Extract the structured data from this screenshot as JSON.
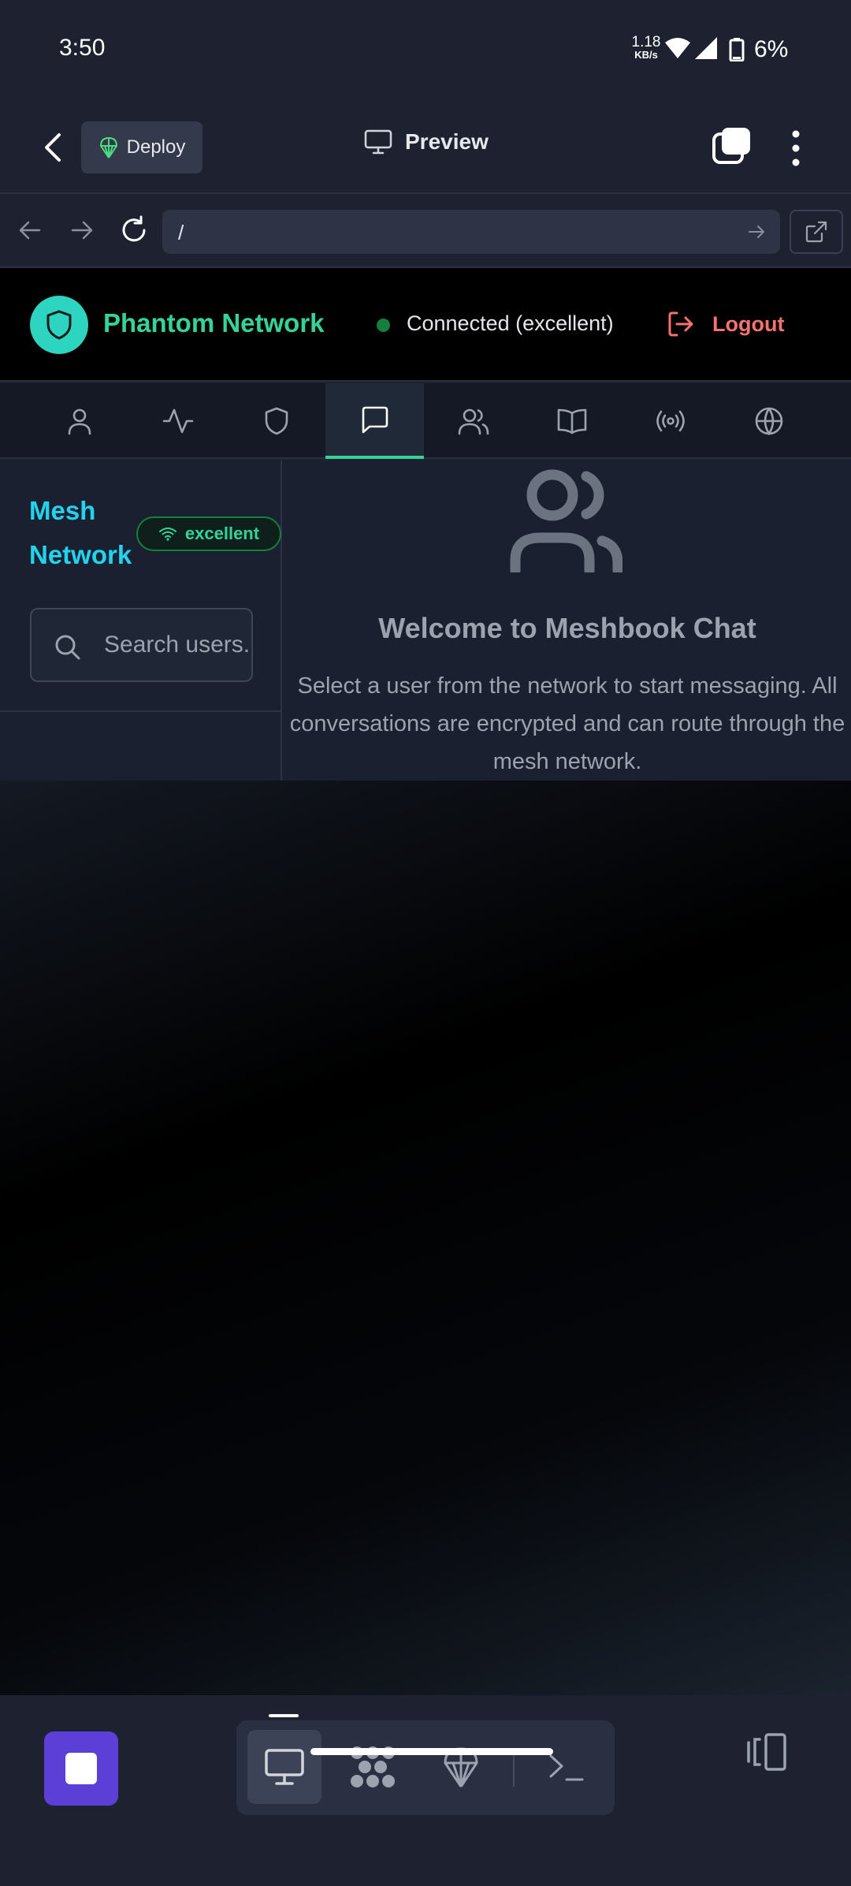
{
  "status_bar": {
    "time": "3:50",
    "net_speed_value": "1.18",
    "net_speed_unit": "KB/s",
    "battery": "6%"
  },
  "toolbar": {
    "deploy_label": "Deploy",
    "preview_label": "Preview"
  },
  "browser": {
    "url": "/"
  },
  "app": {
    "brand_name": "Phantom Network",
    "connection_status": "Connected (excellent)",
    "logout_label": "Logout",
    "nav_tabs": [
      {
        "name": "profile",
        "icon": "user-icon"
      },
      {
        "name": "activity",
        "icon": "activity-icon"
      },
      {
        "name": "security",
        "icon": "shield-icon"
      },
      {
        "name": "chat",
        "icon": "message-square-icon",
        "active": true
      },
      {
        "name": "users",
        "icon": "users-icon"
      },
      {
        "name": "book",
        "icon": "book-open-icon"
      },
      {
        "name": "broadcast",
        "icon": "radio-icon"
      },
      {
        "name": "globe",
        "icon": "globe-icon"
      }
    ]
  },
  "chat": {
    "sidebar_title": "Mesh Network",
    "quality_badge": "excellent",
    "search_placeholder": "Search users...",
    "welcome_title": "Welcome to Meshbook Chat",
    "welcome_text": "Select a user from the network to start messaging. All conversations are encrypted and can route through the mesh network."
  },
  "colors": {
    "accent_green": "#34d399",
    "accent_cyan": "#22d3ee",
    "logout_red": "#f87171",
    "stop_purple": "#5b3fd6"
  }
}
